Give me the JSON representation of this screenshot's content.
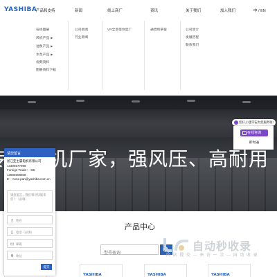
{
  "header": {
    "logo": "YASHIBA",
    "nav": [
      "产品和支持",
      "新闻",
      "线上商厂",
      "资讯",
      "关于我们",
      "加入我们"
    ],
    "lang": "中 / EN"
  },
  "menu": {
    "products": [
      {
        "label": "在线图册",
        "arrow": ""
      },
      {
        "label": "风机产品",
        "arrow": "▶"
      },
      {
        "label": "油泵产品",
        "arrow": "▶"
      },
      {
        "label": "水泵产品",
        "arrow": "▶"
      },
      {
        "label": "视频资料",
        "arrow": ""
      },
      {
        "label": "图册资料下载",
        "arrow": ""
      }
    ],
    "news": [
      "公司新闻",
      "行业新闻"
    ],
    "shop": [
      "VR全景等你逛厂"
    ],
    "info": [
      "通借和荣誉"
    ],
    "about": [
      "公司简介",
      "发展历程",
      "联系我们"
    ]
  },
  "hero": {
    "title": "专业风机厂家，强风压、高耐用"
  },
  "product_center": {
    "title": "产品中心",
    "search_placeholder": "型号查询",
    "cards": [
      "YASHIBA",
      "YASHIBA",
      "YASHIBA",
      "YASHIBA"
    ]
  },
  "chat": {
    "header": "请您留言",
    "company": "浙江亚士霸电机有限公司",
    "phone": "13306577988",
    "foreign_trade": "Foreign Trade：+86 13666608508",
    "email": "E：Anne.pan@yashiba.com.cn",
    "message_placeholder": "请您留言，我们将尽快联系您！（必填）",
    "name_placeholder": "姓名",
    "tel_placeholder": "电话（必填）",
    "mail_placeholder": "邮箱",
    "addr_placeholder": "地址",
    "submit": "提交"
  },
  "online": {
    "banner": "您好,小蛋宇宙为您服务啦!",
    "button": "在线咨询",
    "chat_label": "即时通"
  },
  "watermark": {
    "title": "自动秒收录",
    "subtitle": "网 站 提 交 — 来 访 一 次 — 自 动 收 录"
  }
}
